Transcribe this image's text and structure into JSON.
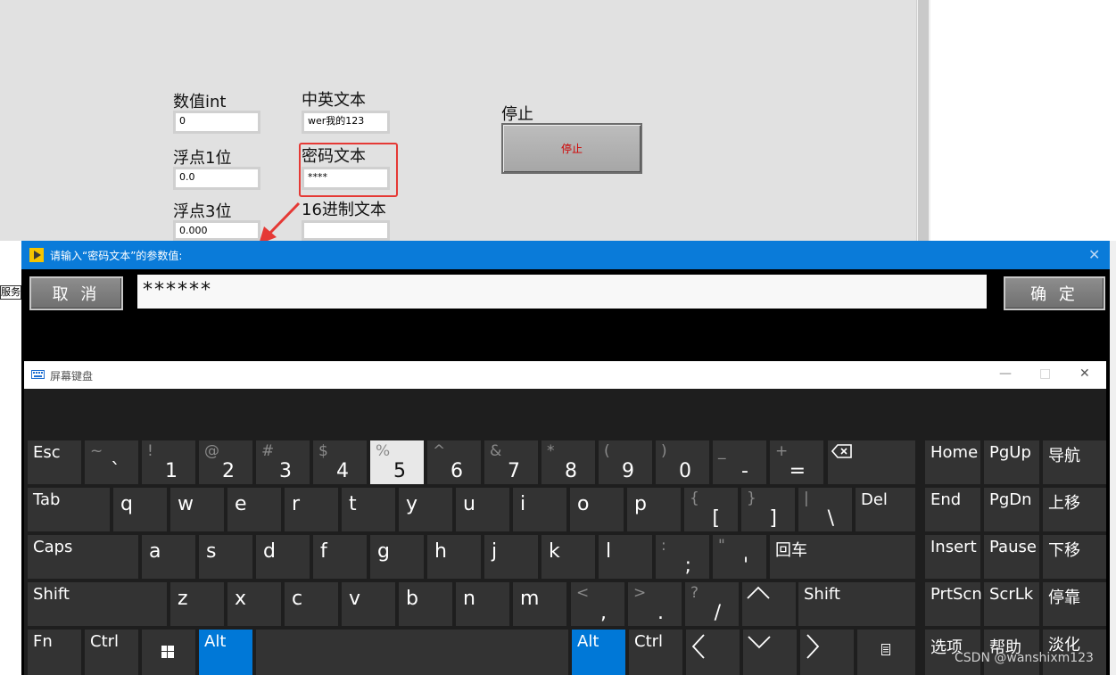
{
  "front_panel": {
    "labels": {
      "int": "数值int",
      "mixed": "中英文本",
      "float1": "浮点1位",
      "password": "密码文本",
      "float3": "浮点3位",
      "hex": "16进制文本",
      "stop_label": "停止"
    },
    "values": {
      "int": "0",
      "mixed": "wer我的123",
      "float1": "0.0",
      "password": "****",
      "float3": "0.000",
      "hex": ""
    },
    "stop_button": "停止",
    "side_fragment": "服务器"
  },
  "dialog": {
    "title": "请输入“密码文本”的参数值:",
    "close": "✕",
    "cancel": "取 消",
    "ok": "确 定",
    "input_value": "******"
  },
  "osk": {
    "title": "屏幕键盘",
    "minimize": "—",
    "maximize": "□",
    "close": "✕",
    "keys": {
      "esc": "Esc",
      "tab": "Tab",
      "caps": "Caps",
      "shift_l": "Shift",
      "shift_r": "Shift",
      "fn": "Fn",
      "ctrl_l": "Ctrl",
      "ctrl_r": "Ctrl",
      "alt_l": "Alt",
      "alt_r": "Alt",
      "del": "Del",
      "enter": "回车",
      "home": "Home",
      "pgup": "PgUp",
      "nav": "导航",
      "end": "End",
      "pgdn": "PgDn",
      "moveup": "上移",
      "insert": "Insert",
      "pause": "Pause",
      "movedown": "下移",
      "prtscn": "PrtScn",
      "scrlk": "ScrLk",
      "dock": "停靠",
      "options": "选项",
      "help": "帮助",
      "fade": "淡化"
    },
    "number_row": [
      {
        "top": "~",
        "bot": "`"
      },
      {
        "top": "!",
        "bot": "1"
      },
      {
        "top": "@",
        "bot": "2"
      },
      {
        "top": "#",
        "bot": "3"
      },
      {
        "top": "$",
        "bot": "4"
      },
      {
        "top": "%",
        "bot": "5"
      },
      {
        "top": "^",
        "bot": "6"
      },
      {
        "top": "&",
        "bot": "7"
      },
      {
        "top": "*",
        "bot": "8"
      },
      {
        "top": "(",
        "bot": "9"
      },
      {
        "top": ")",
        "bot": "0"
      },
      {
        "top": "_",
        "bot": "-"
      },
      {
        "top": "+",
        "bot": "="
      }
    ],
    "row_q": [
      "q",
      "w",
      "e",
      "r",
      "t",
      "y",
      "u",
      "i",
      "o",
      "p"
    ],
    "row_q_sym": [
      {
        "top": "{",
        "bot": "["
      },
      {
        "top": "}",
        "bot": "]"
      },
      {
        "top": "|",
        "bot": "\\"
      }
    ],
    "row_a": [
      "a",
      "s",
      "d",
      "f",
      "g",
      "h",
      "j",
      "k",
      "l"
    ],
    "row_a_sym": [
      {
        "top": ":",
        "bot": ";"
      },
      {
        "top": "\"",
        "bot": "'"
      }
    ],
    "row_z": [
      "z",
      "x",
      "c",
      "v",
      "b",
      "n",
      "m"
    ],
    "row_z_sym": [
      {
        "top": "<",
        "bot": ","
      },
      {
        "top": ">",
        "bot": "."
      },
      {
        "top": "?",
        "bot": "/"
      }
    ]
  },
  "watermark": "CSDN @wanshixm123",
  "colors": {
    "title_blue": "#0a7bd9",
    "key_bg": "#333333",
    "key_active": "#0078d7",
    "highlight": "#e53935"
  }
}
